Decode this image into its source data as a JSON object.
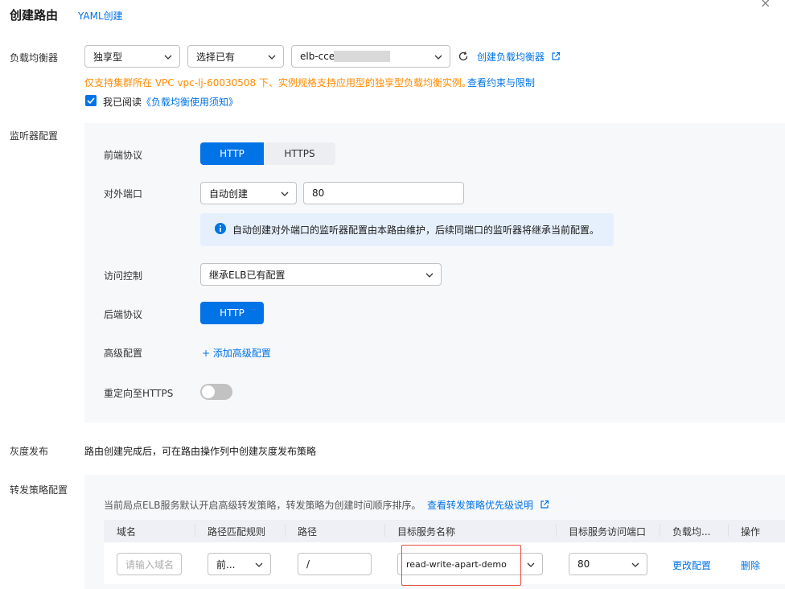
{
  "header": {
    "title": "创建路由",
    "yaml_link": "YAML创建"
  },
  "load_balancer": {
    "label": "负载均衡器",
    "type_value": "独享型",
    "source_value": "选择已有",
    "elb_value": "elb-cce",
    "create_link": "创建负载均衡器",
    "notice": "仅支持集群所在 VPC vpc-lj-60030508 下、实例规格支持应用型的独享型负载均衡实例。",
    "constraints_link": "查看约束与限制",
    "agree_prefix": "我已阅读",
    "agree_link": "《负载均衡使用须知》"
  },
  "listener": {
    "label": "监听器配置",
    "frontend_label": "前端协议",
    "frontend_options": [
      "HTTP",
      "HTTPS"
    ],
    "port_label": "对外端口",
    "port_mode": "自动创建",
    "port_value": "80",
    "port_info": "自动创建对外端口的监听器配置由本路由维护，后续同端口的监听器将继承当前配置。",
    "access_label": "访问控制",
    "access_value": "继承ELB已有配置",
    "backend_label": "后端协议",
    "backend_value": "HTTP",
    "advanced_label": "高级配置",
    "advanced_link": "+ 添加高级配置",
    "redirect_label": "重定向至HTTPS"
  },
  "gray": {
    "label": "灰度发布",
    "text": "路由创建完成后，可在路由操作列中创建灰度发布策略"
  },
  "forward": {
    "label": "转发策略配置",
    "notice": "当前局点ELB服务默认开启高级转发策略，转发策略为创建时间顺序排序。",
    "priority_link": "查看转发策略优先级说明",
    "columns": [
      "域名",
      "路径匹配规则",
      "路径",
      "目标服务名称",
      "目标服务访问端口",
      "负载均...",
      "操作"
    ],
    "row": {
      "domain_placeholder": "请输入域名",
      "match_value": "前...",
      "path_value": "/",
      "service_value": "read-write-apart-demo",
      "port_value": "80",
      "edit_link": "更改配置",
      "delete_link": "删除"
    }
  },
  "colors": {
    "primary": "#0073e6",
    "warning": "#ff8a00",
    "highlight": "#e84e40"
  }
}
